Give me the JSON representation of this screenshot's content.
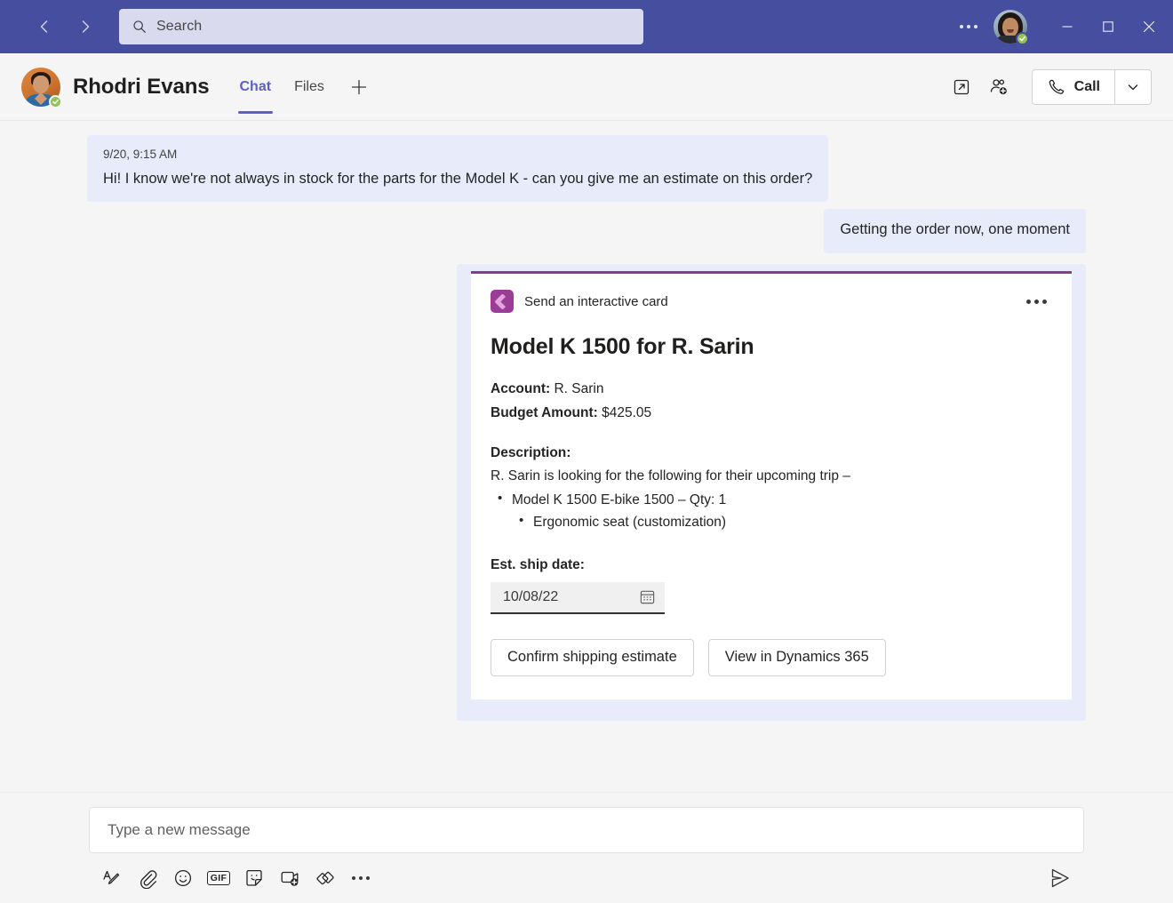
{
  "titlebar": {
    "back_icon": "chevron-left-icon",
    "forward_icon": "chevron-right-icon",
    "search": {
      "placeholder": "Search",
      "icon": "search-icon"
    },
    "more_icon": "ellipsis-icon",
    "avatar": {
      "name": "avatar",
      "presence": "available"
    },
    "minimize_label": "—",
    "maximize_label": "□",
    "close_label": "✕",
    "background_color": "#464ea0",
    "search_background": "#d9daee"
  },
  "chat_header": {
    "contact_name": "Rhodri Evans",
    "presence": "available",
    "tabs": [
      {
        "label": "Chat",
        "active": true
      },
      {
        "label": "Files",
        "active": false
      }
    ],
    "add_tab_icon": "plus-icon",
    "popout_icon": "open-in-new-window-icon",
    "add_people_icon": "add-person-icon",
    "call_label": "Call",
    "call_icon": "phone-icon",
    "call_caret_icon": "chevron-down-icon",
    "accent_color": "#5b5fc7"
  },
  "messages": [
    {
      "side": "left",
      "timestamp": "9/20, 9:15 AM",
      "text": "Hi! I know we're not always in stock for the parts for the Model K - can you give me an estimate on this order?"
    },
    {
      "side": "right",
      "timestamp": "",
      "text": "Getting the order now, one moment"
    }
  ],
  "bubble_color": "#e8ebfa",
  "card": {
    "accent_color": "#8a3b8f",
    "app_icon": "power-automate-icon",
    "source_label": "Send an interactive card",
    "more_icon": "ellipsis-icon",
    "title": "Model K 1500 for R. Sarin",
    "fields": [
      {
        "label": "Account:",
        "value": "R. Sarin"
      },
      {
        "label": "Budget Amount:",
        "value": "$425.05"
      }
    ],
    "description_label": "Description:",
    "description_text": "R. Sarin is looking for the following for their upcoming trip –",
    "bullets": [
      {
        "text": "Model K 1500 E-bike 1500 – Qty: 1",
        "level": 1
      },
      {
        "text": "Ergonomic seat (customization)",
        "level": 2
      }
    ],
    "date_label": "Est. ship date:",
    "date_value": "10/08/22",
    "date_icon": "calendar-icon",
    "actions": [
      {
        "label": "Confirm shipping estimate"
      },
      {
        "label": "View in Dynamics 365"
      }
    ]
  },
  "compose": {
    "placeholder": "Type a new message",
    "value": "",
    "tools": [
      {
        "name": "format-icon",
        "glyph": "A"
      },
      {
        "name": "attach-icon",
        "glyph": ""
      },
      {
        "name": "emoji-icon",
        "glyph": ""
      },
      {
        "name": "gif-icon",
        "glyph": "GIF"
      },
      {
        "name": "sticker-icon",
        "glyph": ""
      },
      {
        "name": "meet-now-icon",
        "glyph": ""
      },
      {
        "name": "loop-component-icon",
        "glyph": ""
      },
      {
        "name": "more-options-icon",
        "glyph": ""
      }
    ],
    "send_icon": "send-icon"
  }
}
